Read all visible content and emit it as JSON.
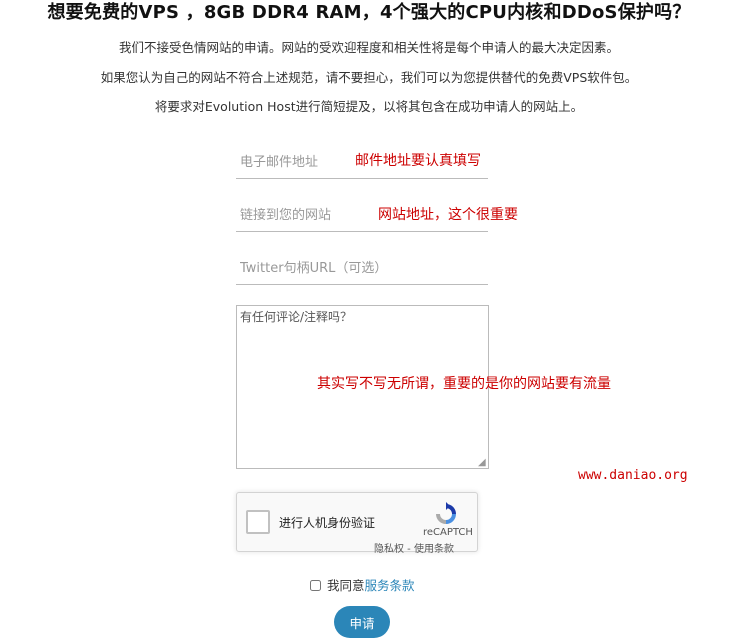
{
  "header": {
    "title": "想要免费的VPS ，8GB DDR4 RAM，4个强大的CPU内核和DDoS保护吗？"
  },
  "intro": {
    "line1": "我们不接受色情网站的申请。网站的受欢迎程度和相关性将是每个申请人的最大决定因素。",
    "line2": "如果您认为自己的网站不符合上述规范，请不要担心，我们可以为您提供替代的免费VPS软件包。",
    "line3": "将要求对Evolution Host进行简短提及，以将其包含在成功申请人的网站上。"
  },
  "form": {
    "email_placeholder": "电子邮件地址",
    "url_placeholder": "链接到您的网站",
    "twitter_placeholder": "Twitter句柄URL（可选）",
    "comments_placeholder": "有任何评论/注释吗？",
    "agree_prefix": "我同意",
    "agree_link": "服务条款",
    "submit_label": "申请"
  },
  "captcha": {
    "label": "进行人机身份验证",
    "brand": "reCAPTCH",
    "privacy": "隐私权",
    "separator": " - ",
    "terms": "使用条款",
    "checked": false
  },
  "annotations": {
    "email_note": "邮件地址要认真填写",
    "url_note": "网站地址，这个很重要",
    "comment_note": "其实写不写无所谓，重要的是你的网站要有流量",
    "watermark": "www.daniao.org"
  },
  "colors": {
    "accent": "#2b86b8",
    "annotation": "#cc0000"
  }
}
